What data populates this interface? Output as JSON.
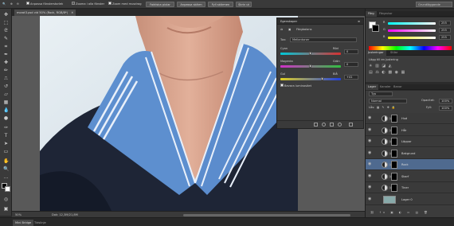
{
  "options_bar": {
    "zoom_resize_windows": "Anpassa fönsterstorlek",
    "zoom_all_windows": "Zooma i alla fönster",
    "scrubby_zoom": "Zoom med musdrag",
    "actual_pixels": "Faktiska pixlar",
    "fit_screen": "Anpassa skärm",
    "fill_screen": "Fyll skärmen",
    "print_size": "Skriv ut",
    "workspace": "Grundläggande"
  },
  "document": {
    "tab_title": "morot3.psd vid 50% (Rock, RGB/8*)",
    "zoom_level": "50%",
    "doc_info": "Dok: 12,3M/21,8M"
  },
  "properties": {
    "header": "Egenskaper",
    "panel_title": "Färgbalans",
    "tone_label": "Ton:",
    "tone_value": "Mellantoner",
    "slider1_left": "Cyan",
    "slider1_right": "Röd",
    "slider1_value": "0",
    "slider2_left": "Magenta",
    "slider2_right": "Grön",
    "slider2_value": "0",
    "slider3_left": "Gul",
    "slider3_right": "Blå",
    "slider3_value": "+41",
    "preserve_luminosity": "Bevara luminositet"
  },
  "color_panel": {
    "tabs": [
      "Färg",
      "Färgrutor"
    ],
    "r_value": "255",
    "g_value": "255",
    "b_value": "255"
  },
  "adjustments_panel": {
    "tabs": [
      "Justeringar",
      "Stilar"
    ],
    "hint": "Lägg till en justering"
  },
  "layers_panel": {
    "tabs": [
      "Lager",
      "Kanaler",
      "Banor"
    ],
    "kind": "Typ",
    "blend_mode": "Normal",
    "opacity_label": "Opacitet:",
    "opacity_value": "100%",
    "lock_label": "Lås:",
    "fill_label": "Fyll:",
    "fill_value": "100%",
    "layers": [
      {
        "name": "Hud",
        "selected": false
      },
      {
        "name": "Hår",
        "selected": false
      },
      {
        "name": "Läppar",
        "selected": false
      },
      {
        "name": "Bakgrund",
        "selected": false
      },
      {
        "name": "Rock",
        "selected": true
      },
      {
        "name": "Skarf",
        "selected": false
      },
      {
        "name": "Tiner",
        "selected": false
      },
      {
        "name": "Lager 0",
        "selected": false
      }
    ]
  },
  "bottom_tabs": [
    "Mini Bridge",
    "Tidslinje"
  ],
  "colors": {
    "selection": "#4f6a8f",
    "panel_bg": "#3c3c3c"
  }
}
